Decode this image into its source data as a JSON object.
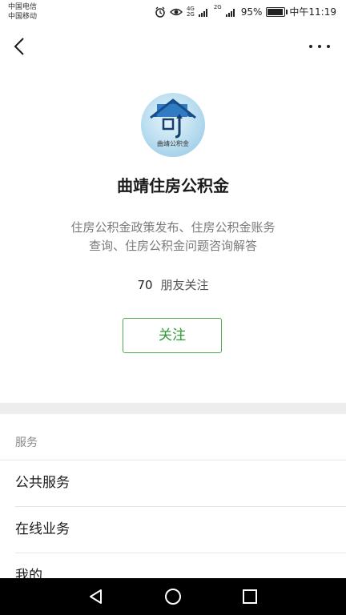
{
  "status": {
    "carrier_1": "中国电信",
    "carrier_2": "中国移动",
    "net_tag_top": "4G",
    "net_tag_bottom": "2G",
    "net_tag_2": "2G",
    "battery": "95%",
    "battery_level": 0.95,
    "time": "中午11:19"
  },
  "icons": {
    "back": "back-arrow-icon",
    "more": "more-dots-icon",
    "alarm": "alarm-icon",
    "eye": "eye-icon",
    "signal": "signal-icon",
    "battery": "battery-icon",
    "nav_back": "triangle-back-icon",
    "nav_home": "circle-home-icon",
    "nav_recent": "square-recents-icon"
  },
  "profile": {
    "logo_text": "曲靖公积金",
    "name": "曲靖住房公积金",
    "desc_line1": "住房公积金政策发布、住房公积金账务",
    "desc_line2": "查询、住房公积金问题咨询解答",
    "follower_count": "70",
    "follower_label": "朋友关注",
    "follow_button": "关注"
  },
  "menu": {
    "header": "服务",
    "items": [
      {
        "label": "公共服务"
      },
      {
        "label": "在线业务"
      },
      {
        "label": "我的"
      }
    ]
  },
  "colors": {
    "accent_green": "#2f9a35",
    "separator": "#ededed"
  }
}
